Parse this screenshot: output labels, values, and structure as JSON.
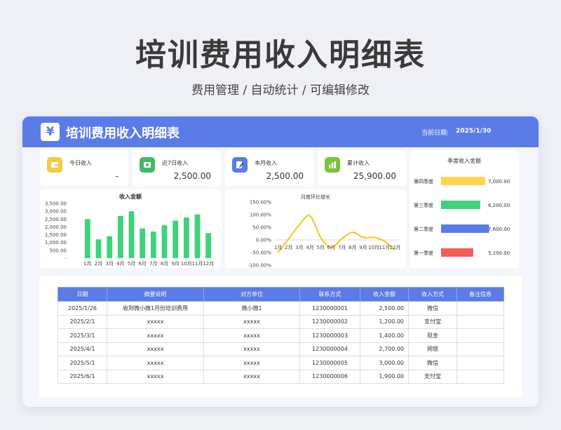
{
  "page": {
    "title": "培训费用收入明细表",
    "subtitle": "费用管理 /  自动统计  /  可编辑修改"
  },
  "header": {
    "icon": "yen-icon",
    "icon_glyph": "¥",
    "title": "培训费用收入明细表",
    "date_label": "当前日期:",
    "date_value": "2025/1/30"
  },
  "stats": [
    {
      "label": "今日收入",
      "value": "-",
      "icon": "wallet-icon",
      "color": "#f6c946"
    },
    {
      "label": "近7日收入",
      "value": "2,500.00",
      "icon": "cash-icon",
      "color": "#3fba6a"
    },
    {
      "label": "本月收入",
      "value": "2,500.00",
      "icon": "edit-icon",
      "color": "#5b7be6"
    },
    {
      "label": "累计收入",
      "value": "25,900.00",
      "icon": "bar-chart-icon",
      "color": "#7cc33a"
    }
  ],
  "colors": {
    "accent": "#5b7be6",
    "green": "#3fd27a",
    "yellow": "#f5c518",
    "red": "#f35b57"
  },
  "chart_data": [
    {
      "type": "bar",
      "title": "收入金额",
      "categories": [
        "1月",
        "2月",
        "3月",
        "4月",
        "5月",
        "6月",
        "7月",
        "8月",
        "9月",
        "10月",
        "11月",
        "12月"
      ],
      "values": [
        2500,
        1200,
        1400,
        2700,
        3000,
        1900,
        1700,
        2100,
        2400,
        2600,
        2800,
        1600
      ],
      "yticks": [
        "3,500.00",
        "3,000.00",
        "2,500.00",
        "2,000.00",
        "1,500.00",
        "1,000.00",
        "500.00",
        "-"
      ],
      "ylim": [
        0,
        3500
      ]
    },
    {
      "type": "line",
      "title": "月度环比增长",
      "categories": [
        "1月",
        "2月",
        "3月",
        "4月",
        "5月",
        "6月",
        "7月",
        "8月",
        "9月",
        "10月",
        "11月",
        "12月"
      ],
      "values": [
        -50,
        5,
        60,
        95,
        10,
        -30,
        5,
        30,
        10,
        10,
        -5,
        -40
      ],
      "yticks": [
        "150.00%",
        "100.00%",
        "50.00%",
        "0.00%",
        "-50.00%",
        "-100.00%"
      ],
      "ylim": [
        -100,
        150
      ]
    },
    {
      "type": "bar",
      "title": "季度收入金额",
      "categories": [
        "第四季度",
        "第三季度",
        "第二季度",
        "第一季度"
      ],
      "values": [
        7000,
        6200,
        7600,
        5100
      ],
      "value_labels": [
        "7,000.00",
        "6,200.00",
        "7,600.00",
        "5,100.00"
      ],
      "colors": [
        "#ffd54f",
        "#3fd27a",
        "#5b7be6",
        "#f35b57"
      ]
    }
  ],
  "table": {
    "headers": [
      "日期",
      "摘要说明",
      "对方单位",
      "联系方式",
      "收入金额",
      "收入方式",
      "备注信息"
    ],
    "rows": [
      [
        "2025/1/26",
        "收到微小微1月份培训费用",
        "微小微1",
        "1230000001",
        "2,500.00",
        "微信",
        ""
      ],
      [
        "2025/2/1",
        "xxxxx",
        "xxxxx",
        "1230000002",
        "1,200.00",
        "支付宝",
        ""
      ],
      [
        "2025/3/1",
        "xxxxx",
        "xxxxx",
        "1230000003",
        "1,400.00",
        "现金",
        ""
      ],
      [
        "2025/4/1",
        "xxxxx",
        "xxxxx",
        "1230000004",
        "2,700.00",
        "网银",
        ""
      ],
      [
        "2025/5/1",
        "xxxxx",
        "xxxxx",
        "1230000005",
        "3,000.00",
        "微信",
        ""
      ],
      [
        "2025/6/1",
        "xxxxx",
        "xxxxx",
        "1230000006",
        "1,900.00",
        "支付宝",
        ""
      ]
    ]
  }
}
